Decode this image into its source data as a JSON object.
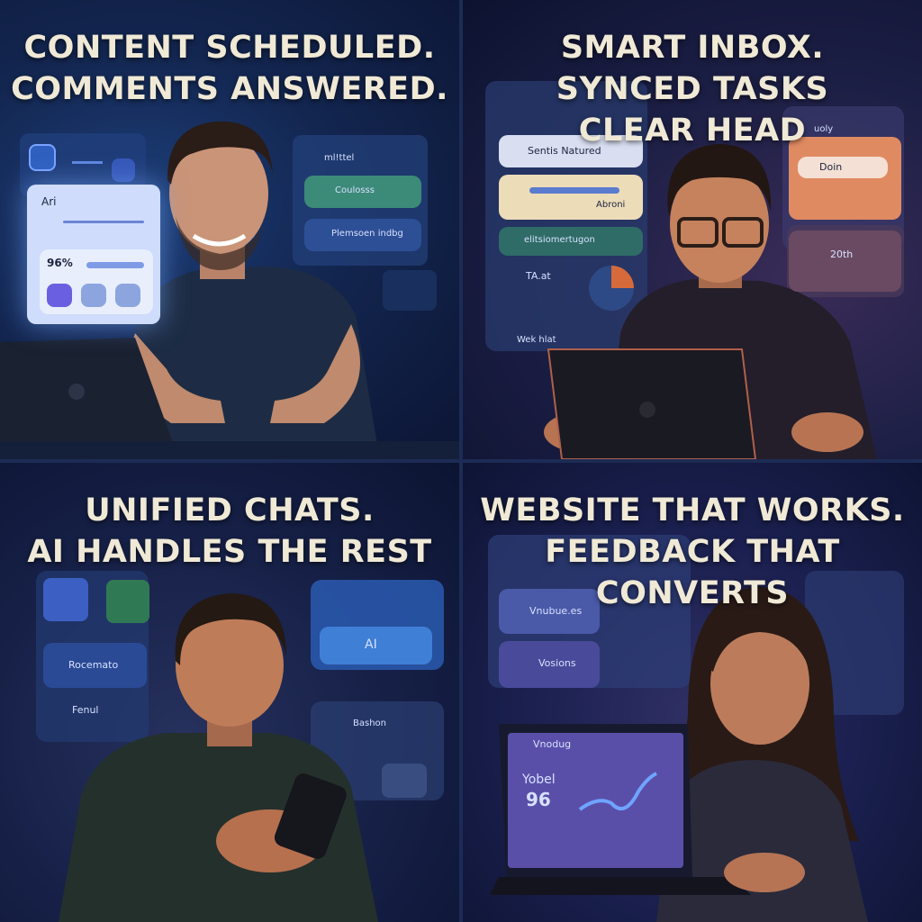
{
  "panels": [
    {
      "headline": [
        "CONTENT SCHEDULED.",
        "COMMENTS ANSWERED."
      ],
      "ui_text": {
        "card_label": "Ari",
        "percent": "96%",
        "list_item_1": "ml!ttel",
        "list_item_2": "Coulosss",
        "list_item_3": "Plemsoen indbg"
      }
    },
    {
      "headline": [
        "SMART INBOX.",
        "SYNCED TASKS",
        "CLEAR HEAD"
      ],
      "ui_text": {
        "item_1": "Sentis Natured",
        "item_2": "Abroni",
        "item_3": "elitsiomertugon",
        "item_4": "TA.at",
        "item_5": "Wek hlat",
        "card_1": "Doin",
        "card_2": "20th",
        "top": "uoly"
      }
    },
    {
      "headline": [
        "UNIFIED CHATS.",
        "AI HANDLES THE REST"
      ],
      "ui_text": {
        "item_1": "Rocemato",
        "item_2": "Fenul",
        "ai_label": "AI",
        "item_3": "Bashon"
      }
    },
    {
      "headline": [
        "WEBSITE THAT WORKS.",
        "FEEDBACK THAT CONVERTS"
      ],
      "ui_text": {
        "item_1": "Vnubue.es",
        "item_2": "Vosions",
        "screen_title": "Vnodug",
        "screen_label": "Yobel",
        "screen_value": "96"
      }
    }
  ]
}
